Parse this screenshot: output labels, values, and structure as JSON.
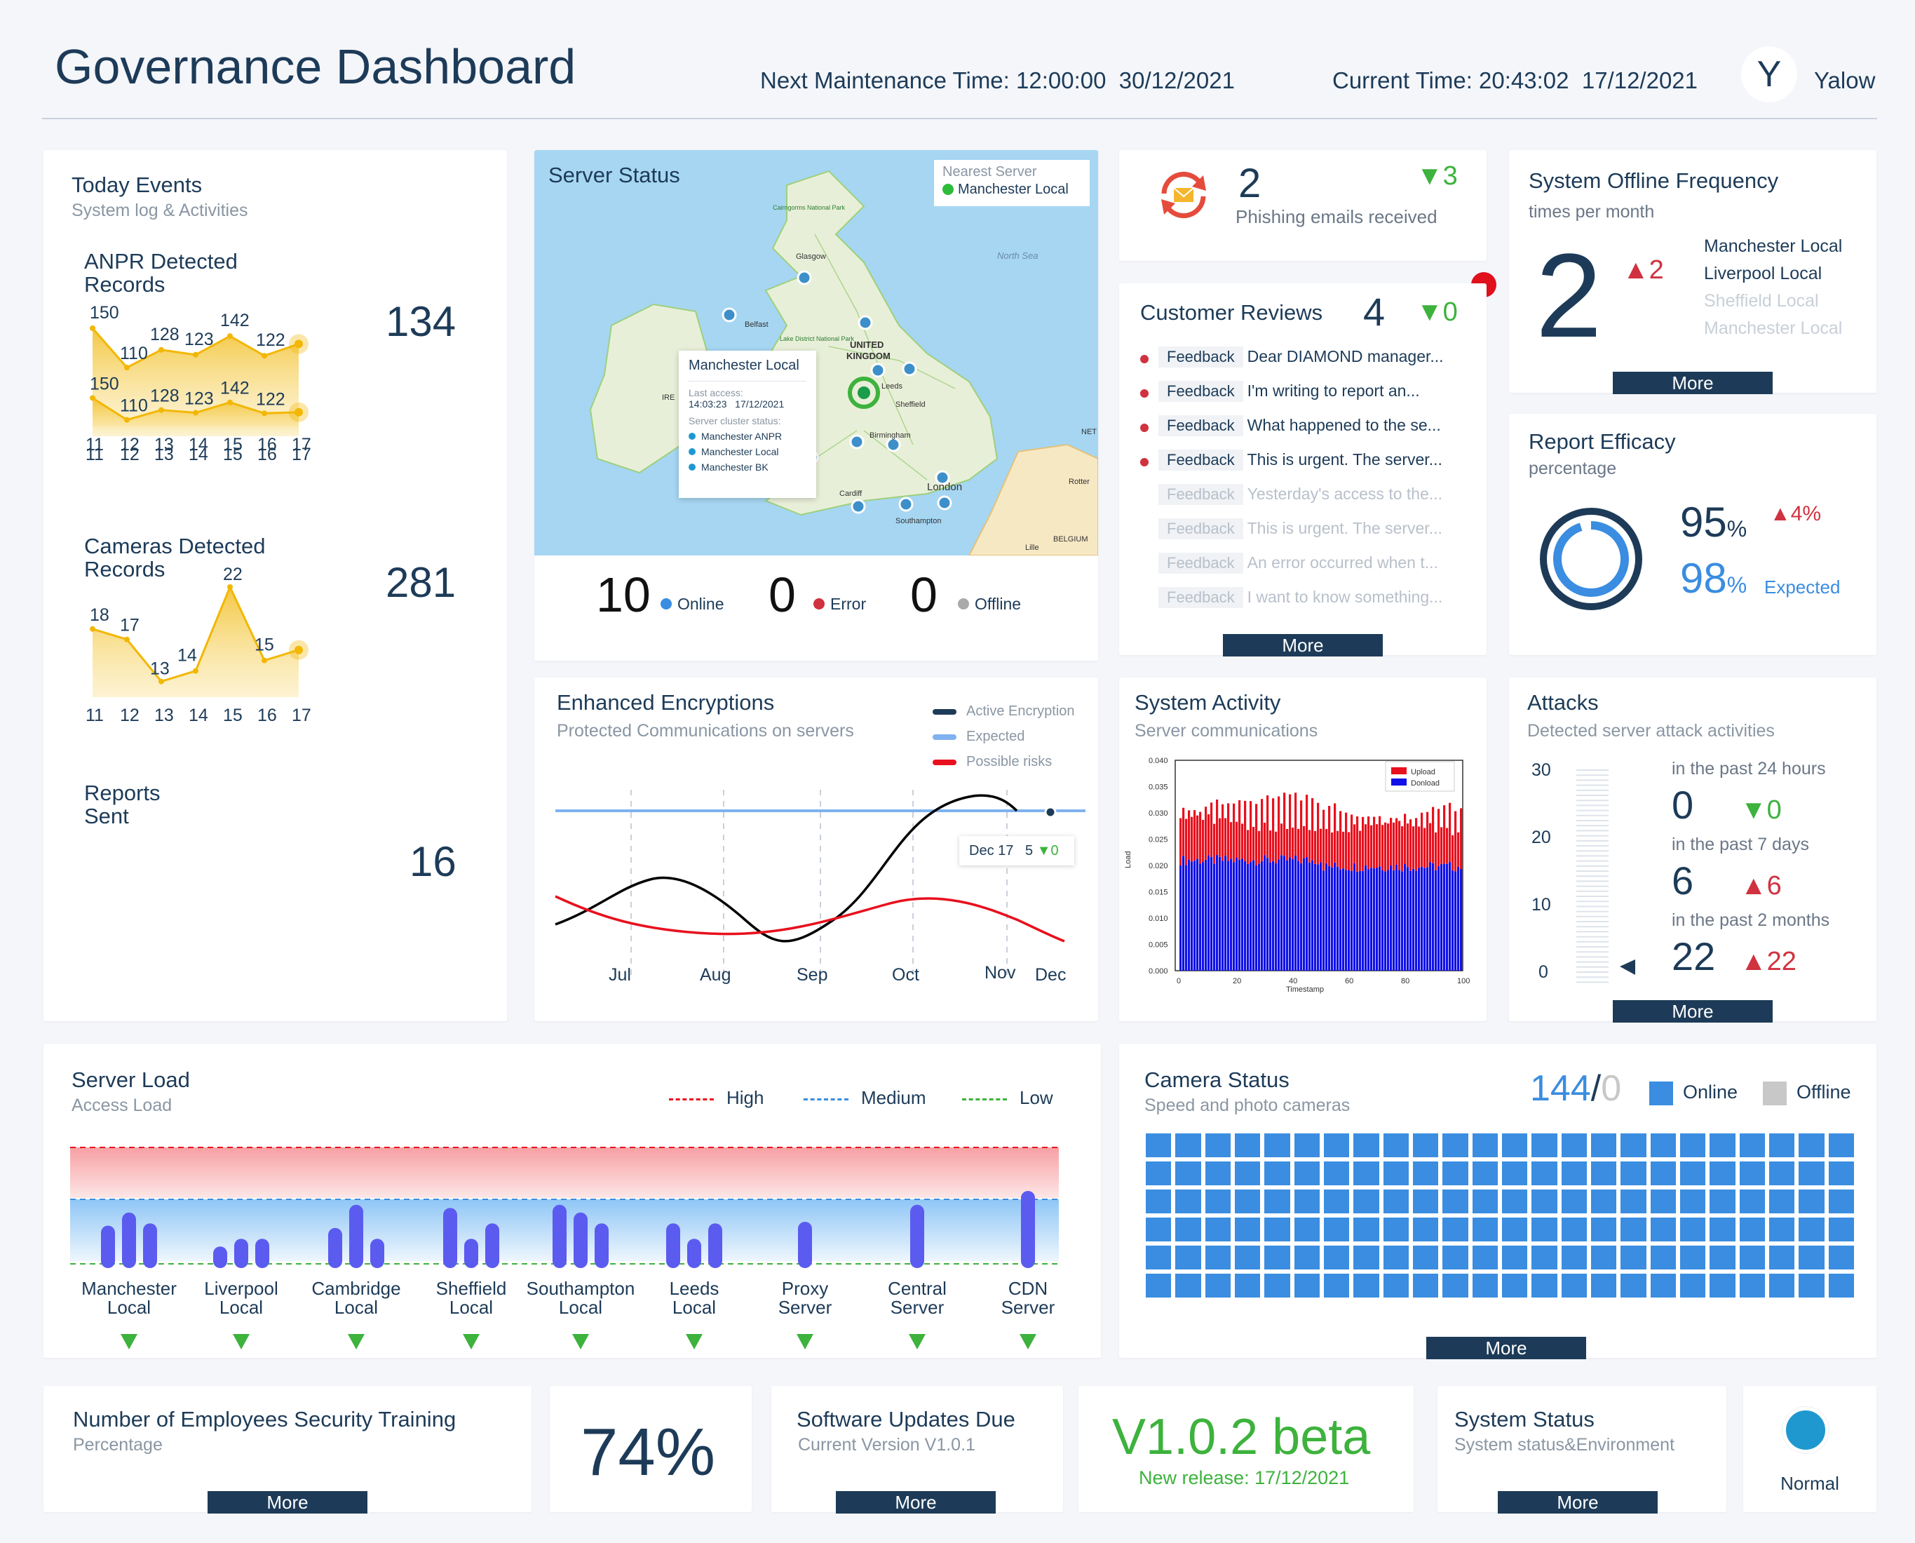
{
  "header": {
    "title": "Governance Dashboard",
    "maintenance": "Next Maintenance Time: 12:00:00  30/12/2021",
    "current_time": "Current Time: 20:43:02  17/12/2021",
    "avatar_initial": "Y",
    "username": "Yalow"
  },
  "today_events": {
    "title": "Today Events",
    "subtitle": "System log & Activities",
    "days": [
      "11",
      "12",
      "13",
      "14",
      "15",
      "16",
      "17"
    ],
    "anpr": {
      "label_1": "ANPR Detected",
      "label_2": "Records",
      "total": "134",
      "values": [
        150,
        110,
        128,
        123,
        142,
        122,
        134
      ],
      "labels": [
        "150",
        "110",
        "128",
        "123",
        "142",
        "122"
      ]
    },
    "cameras": {
      "label_1": "Cameras Detected",
      "label_2": "Records",
      "total": "281",
      "values": [
        150,
        110,
        128,
        123,
        142,
        122,
        281
      ],
      "labels": [
        "150",
        "110",
        "128",
        "123",
        "142",
        "122"
      ]
    },
    "reports": {
      "label_1": "Reports",
      "label_2": "Sent",
      "total": "16",
      "values": [
        18,
        17,
        13,
        14,
        22,
        15,
        16
      ],
      "labels": [
        "18",
        "17",
        "13",
        "14",
        "22",
        "15"
      ]
    }
  },
  "server_status": {
    "title": "Server Status",
    "nearest_label": "Nearest Server",
    "nearest_value": "Manchester Local",
    "popup": {
      "title": "Manchester Local",
      "last_access_label": "Last access:",
      "last_access_time": "14:03:23",
      "last_access_date": "17/12/2021",
      "cluster_label": "Server cluster status:",
      "cluster": [
        "Manchester ANPR",
        "Manchester Local",
        "Manchester BK"
      ]
    },
    "map_labels": {
      "sea": "North Sea",
      "uk_1": "UNITED",
      "uk_2": "KINGDOM",
      "glasgow": "Glasgow",
      "belfast": "Belfast",
      "leeds": "Leeds",
      "sheffield": "Sheffield",
      "birmingham": "Birmingham",
      "london": "London",
      "cardiff": "Cardiff",
      "southampton": "Southampton",
      "cairngorms": "Cairngorms National Park",
      "lake": "Lake District National Park",
      "belgium": "BELGIUM",
      "irl": "IRE",
      "net": "NET",
      "rotter": "Rotter",
      "lille": "Lille"
    },
    "online": "10",
    "online_label": "Online",
    "error": "0",
    "error_label": "Error",
    "offline": "0",
    "offline_label": "Offline"
  },
  "phishing": {
    "count": "2",
    "change": "▼3",
    "label": "Phishing emails received"
  },
  "reviews": {
    "title": "Customer Reviews",
    "count": "4",
    "change": "▼0",
    "more": "More",
    "items": [
      {
        "tag": "Feedback",
        "text": "Dear DIAMOND manager..."
      },
      {
        "tag": "Feedback",
        "text": "I'm writing to report an..."
      },
      {
        "tag": "Feedback",
        "text": "What happened to the se..."
      },
      {
        "tag": "Feedback",
        "text": "This is urgent. The server..."
      },
      {
        "tag": "Feedback",
        "text": "Yesterday's access to the..."
      },
      {
        "tag": "Feedback",
        "text": "This is urgent. The server..."
      },
      {
        "tag": "Feedback",
        "text": "An error occurred when t..."
      },
      {
        "tag": "Feedback",
        "text": "I want to know something..."
      }
    ]
  },
  "offline_freq": {
    "title": "System Offline Frequency",
    "subtitle": "times per month",
    "value": "2",
    "change": "▲2",
    "servers": [
      "Manchester Local",
      "Liverpool Local",
      "Sheffield Local",
      "Manchester Local"
    ],
    "more": "More"
  },
  "report_efficacy": {
    "title": "Report Efficacy",
    "subtitle": "percentage",
    "actual": "95",
    "actual_unit": "%",
    "change": "▲4%",
    "expected": "98",
    "expected_unit": "%",
    "expected_label": "Expected",
    "ring_fraction": 0.95
  },
  "encryption": {
    "title": "Enhanced Encryptions",
    "subtitle": "Protected Communications on servers",
    "legend": [
      "Active Encryption",
      "Expected",
      "Possible risks"
    ],
    "months": [
      "Jul",
      "Aug",
      "Sep",
      "Oct",
      "Nov",
      "Dec"
    ],
    "tooltip_date": "Dec 17",
    "tooltip_value": "5",
    "tooltip_change": "▼0"
  },
  "system_activity": {
    "title": "System Activity",
    "subtitle": "Server communications",
    "legend_upload": "Upload",
    "legend_download": "Donload",
    "ylabel": "Load",
    "xlabel": "Timestamp",
    "yticks": [
      "0.040",
      "0.035",
      "0.030",
      "0.025",
      "0.020",
      "0.015",
      "0.010",
      "0.005",
      "0.000"
    ],
    "xticks": [
      "0",
      "20",
      "40",
      "60",
      "80",
      "100"
    ]
  },
  "attacks": {
    "title": "Attacks",
    "subtitle": "Detected server attack activities",
    "scale": [
      "30",
      "20",
      "10",
      "0"
    ],
    "periods": [
      {
        "label": "in the past 24 hours",
        "value": "0",
        "change": "▼0"
      },
      {
        "label": "in the past 7 days",
        "value": "6",
        "change": "▲6"
      },
      {
        "label": "in the past 2 months",
        "value": "22",
        "change": "▲22"
      }
    ],
    "more": "More"
  },
  "server_load": {
    "title": "Server Load",
    "subtitle": "Access Load",
    "legend": [
      "High",
      "Medium",
      "Low"
    ],
    "servers": [
      {
        "l1": "Manchester",
        "l2": "Local",
        "bars": [
          0.55,
          0.72,
          0.58
        ]
      },
      {
        "l1": "Liverpool",
        "l2": "Local",
        "bars": [
          0.28,
          0.38,
          0.38
        ]
      },
      {
        "l1": "Cambridge",
        "l2": "Local",
        "bars": [
          0.52,
          0.82,
          0.38
        ]
      },
      {
        "l1": "Sheffield",
        "l2": "Local",
        "bars": [
          0.78,
          0.38,
          0.58
        ]
      },
      {
        "l1": "Southampton",
        "l2": "Local",
        "bars": [
          0.82,
          0.72,
          0.58
        ]
      },
      {
        "l1": "Leeds",
        "l2": "Local",
        "bars": [
          0.58,
          0.38,
          0.58
        ]
      },
      {
        "l1": "Proxy",
        "l2": "Server",
        "bars": [
          0.6
        ]
      },
      {
        "l1": "Central",
        "l2": "Server",
        "bars": [
          0.82
        ]
      },
      {
        "l1": "CDN",
        "l2": "Server",
        "bars": [
          1.0
        ]
      }
    ]
  },
  "camera_status": {
    "title": "Camera Status",
    "subtitle": "Speed and photo cameras",
    "online": "144",
    "sep": "/",
    "offline": "0",
    "online_label": "Online",
    "offline_label": "Offline",
    "total_cells": 144,
    "more": "More"
  },
  "training": {
    "title": "Number of Employees Security Training",
    "subtitle": "Percentage",
    "value": "74%",
    "more": "More"
  },
  "updates": {
    "title": "Software Updates Due",
    "subtitle": "Current Version V1.0.1",
    "version": "V1.0.2 beta",
    "release": "New release: 17/12/2021",
    "more": "More"
  },
  "system_status": {
    "title": "System Status",
    "subtitle": "System status&Environment",
    "state": "Normal",
    "more": "More"
  },
  "colors": {
    "navy": "#1d3b58",
    "accent": "#3a8de0",
    "green": "#3db23d",
    "red": "#d0323f",
    "gold": "#f2b705"
  }
}
